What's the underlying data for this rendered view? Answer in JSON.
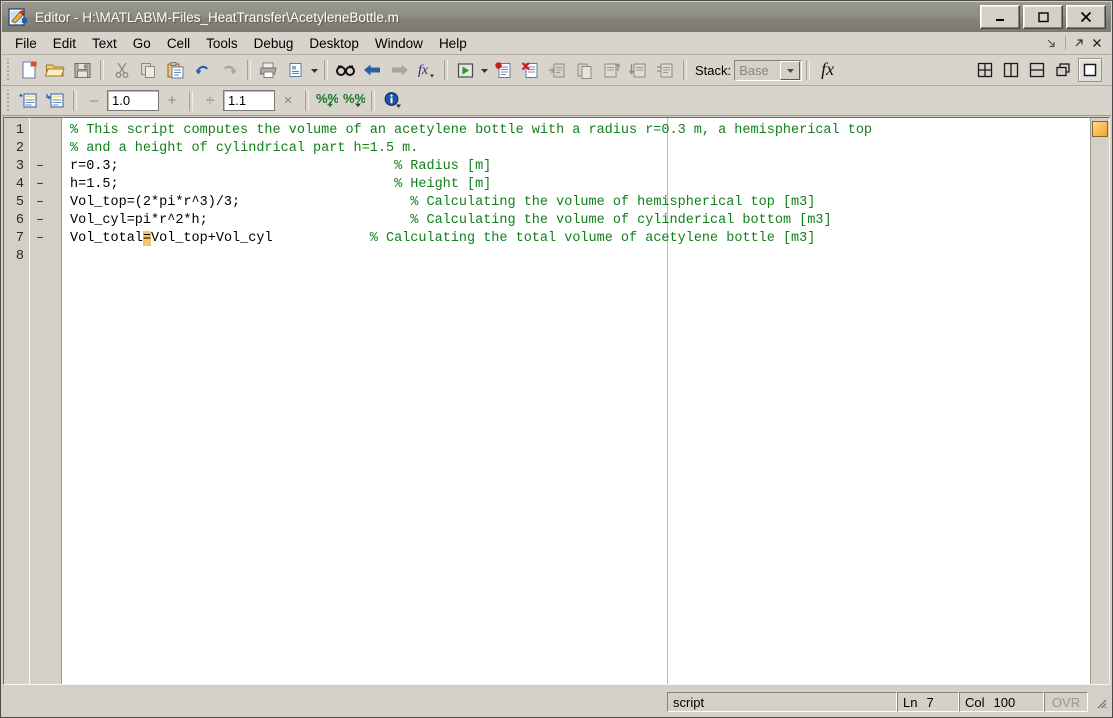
{
  "window": {
    "title": "Editor - H:\\MATLAB\\M-Files_HeatTransfer\\AcetyleneBottle.m",
    "icon": "matlab-editor-icon",
    "minimize_label": "_",
    "maximize_label": "□",
    "close_label": "✕"
  },
  "menu": {
    "items": [
      {
        "label": "File"
      },
      {
        "label": "Edit"
      },
      {
        "label": "Text"
      },
      {
        "label": "Go"
      },
      {
        "label": "Cell"
      },
      {
        "label": "Tools"
      },
      {
        "label": "Debug"
      },
      {
        "label": "Desktop"
      },
      {
        "label": "Window"
      },
      {
        "label": "Help"
      }
    ],
    "right_icons": [
      "dock-arrow-icon",
      "undock-arrow-icon",
      "close-icon"
    ]
  },
  "toolbar_main": {
    "buttons": [
      {
        "name": "new-file-icon",
        "tip": "New"
      },
      {
        "name": "open-file-icon",
        "tip": "Open"
      },
      {
        "name": "save-icon",
        "tip": "Save"
      },
      {
        "name": "cut-icon",
        "tip": "Cut"
      },
      {
        "name": "copy-icon",
        "tip": "Copy"
      },
      {
        "name": "paste-icon",
        "tip": "Paste"
      },
      {
        "name": "undo-icon",
        "tip": "Undo"
      },
      {
        "name": "redo-icon",
        "tip": "Redo"
      },
      {
        "name": "print-icon",
        "tip": "Print"
      },
      {
        "name": "print-preview-icon",
        "tip": "Print Preview"
      },
      {
        "name": "find-icon",
        "tip": "Find Text"
      },
      {
        "name": "back-arrow-icon",
        "tip": "Go Back"
      },
      {
        "name": "forward-arrow-icon",
        "tip": "Go Forward"
      },
      {
        "name": "function-browser-icon",
        "tip": "Function Browser"
      },
      {
        "name": "run-icon",
        "tip": "Run"
      },
      {
        "name": "set-breakpoint-icon",
        "tip": "Set/Clear Breakpoint"
      },
      {
        "name": "clear-breakpoints-icon",
        "tip": "Clear All Breakpoints"
      },
      {
        "name": "step-in-icon",
        "tip": "Step In"
      },
      {
        "name": "step-icon",
        "tip": "Step"
      },
      {
        "name": "step-out-icon",
        "tip": "Step Out"
      },
      {
        "name": "continue-icon",
        "tip": "Continue"
      },
      {
        "name": "exit-debug-icon",
        "tip": "Exit Debug Mode"
      }
    ],
    "stack": {
      "label": "Stack:",
      "value": "Base",
      "options": [
        "Base"
      ]
    },
    "fx_label": "fx",
    "layout_buttons": [
      {
        "name": "tile-layout-icon"
      },
      {
        "name": "split-vertical-icon"
      },
      {
        "name": "split-horizontal-icon"
      },
      {
        "name": "float-window-icon"
      },
      {
        "name": "maximize-pane-icon",
        "active": true
      }
    ]
  },
  "toolbar_cell": {
    "buttons": [
      {
        "name": "insert-cell-divider-icon"
      },
      {
        "name": "insert-cell-divider-text-icon"
      }
    ],
    "minus_label": "–",
    "divisor_field_1": "1.0",
    "plus_label": "+",
    "divide_label": "÷",
    "divisor_field_2": "1.1",
    "times_label": "×",
    "eval_cell_icons": [
      "eval-cell-advance-icon",
      "eval-cell-menu-icon"
    ],
    "info_icon": "info-icon"
  },
  "editor": {
    "mlint_indicator": "mlint-warning-marker",
    "text_limit_column_marker": true,
    "lines": [
      {
        "num": "1",
        "mark": "",
        "segments": [
          {
            "type": "comment",
            "text": "% This script computes the volume of an acetylene bottle with a radius r=0.3 m, a hemispherical top"
          }
        ]
      },
      {
        "num": "2",
        "mark": "",
        "segments": [
          {
            "type": "comment",
            "text": "% and a height of cylindrical part h=1.5 m."
          }
        ]
      },
      {
        "num": "3",
        "mark": "–",
        "segments": [
          {
            "type": "code",
            "text": "r=0.3;"
          },
          {
            "type": "pad",
            "text": "                                  "
          },
          {
            "type": "comment",
            "text": "% Radius [m]"
          }
        ]
      },
      {
        "num": "4",
        "mark": "–",
        "segments": [
          {
            "type": "code",
            "text": "h=1.5;"
          },
          {
            "type": "pad",
            "text": "                                  "
          },
          {
            "type": "comment",
            "text": "% Height [m]"
          }
        ]
      },
      {
        "num": "5",
        "mark": "–",
        "segments": [
          {
            "type": "code",
            "text": "Vol_top=(2*pi*r^3)/3;"
          },
          {
            "type": "pad",
            "text": "                     "
          },
          {
            "type": "comment",
            "text": "% Calculating the volume of hemispherical top [m3]"
          }
        ]
      },
      {
        "num": "6",
        "mark": "–",
        "segments": [
          {
            "type": "code",
            "text": "Vol_cyl=pi*r^2*h;"
          },
          {
            "type": "pad",
            "text": "                         "
          },
          {
            "type": "comment",
            "text": "% Calculating the volume of cylinderical bottom [m3]"
          }
        ]
      },
      {
        "num": "7",
        "mark": "–",
        "segments": [
          {
            "type": "code",
            "text": "Vol_total"
          },
          {
            "type": "warn",
            "text": "="
          },
          {
            "type": "code",
            "text": "Vol_top+Vol_cyl"
          },
          {
            "type": "pad",
            "text": "            "
          },
          {
            "type": "comment",
            "text": "% Calculating the total volume of acetylene bottle [m3]"
          }
        ]
      },
      {
        "num": "8",
        "mark": "",
        "segments": []
      }
    ]
  },
  "statusbar": {
    "file_type": "script",
    "line_label": "Ln",
    "line_value": "7",
    "col_label": "Col",
    "col_value": "100",
    "overwrite_label": "OVR",
    "resize_grip": "resize-grip-icon"
  },
  "colors": {
    "chrome": "#d4d0c8",
    "titlebar": "#8b8980",
    "comment_green": "#10801a",
    "code_black": "#000000",
    "mlint_orange": "#f2a32c"
  }
}
